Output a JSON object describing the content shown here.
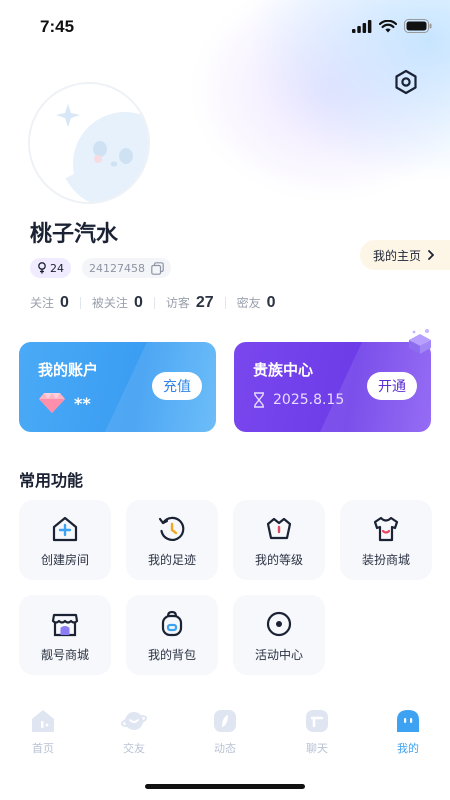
{
  "status_bar": {
    "time": "7:45"
  },
  "profile": {
    "username": "桃子汽水",
    "homepage_label": "我的主页",
    "level": "24",
    "user_id": "24127458"
  },
  "stats": [
    {
      "label": "关注",
      "value": "0"
    },
    {
      "label": "被关注",
      "value": "0"
    },
    {
      "label": "访客",
      "value": "27"
    },
    {
      "label": "密友",
      "value": "0"
    }
  ],
  "cards": {
    "account": {
      "title": "我的账户",
      "balance": "**",
      "button": "充值",
      "color": "#3b9df2"
    },
    "noble": {
      "title": "贵族中心",
      "expiry": "2025.8.15",
      "button": "开通",
      "color": "#6d3ce8"
    }
  },
  "functions": {
    "title": "常用功能",
    "items": [
      {
        "label": "创建房间",
        "icon": "house-plus-icon"
      },
      {
        "label": "我的足迹",
        "icon": "history-clock-icon"
      },
      {
        "label": "我的等级",
        "icon": "level-badge-icon"
      },
      {
        "label": "装扮商城",
        "icon": "tshirt-icon"
      },
      {
        "label": "靓号商城",
        "icon": "shop-icon"
      },
      {
        "label": "我的背包",
        "icon": "backpack-icon"
      },
      {
        "label": "活动中心",
        "icon": "target-icon"
      }
    ]
  },
  "tabbar": {
    "items": [
      {
        "label": "首页",
        "icon": "home-icon"
      },
      {
        "label": "交友",
        "icon": "planet-icon"
      },
      {
        "label": "动态",
        "icon": "moments-icon"
      },
      {
        "label": "聊天",
        "icon": "chat-icon"
      },
      {
        "label": "我的",
        "icon": "profile-face-icon",
        "active": true
      }
    ],
    "active_color": "#3ea2f2",
    "inactive_color": "#c7d0e0"
  }
}
